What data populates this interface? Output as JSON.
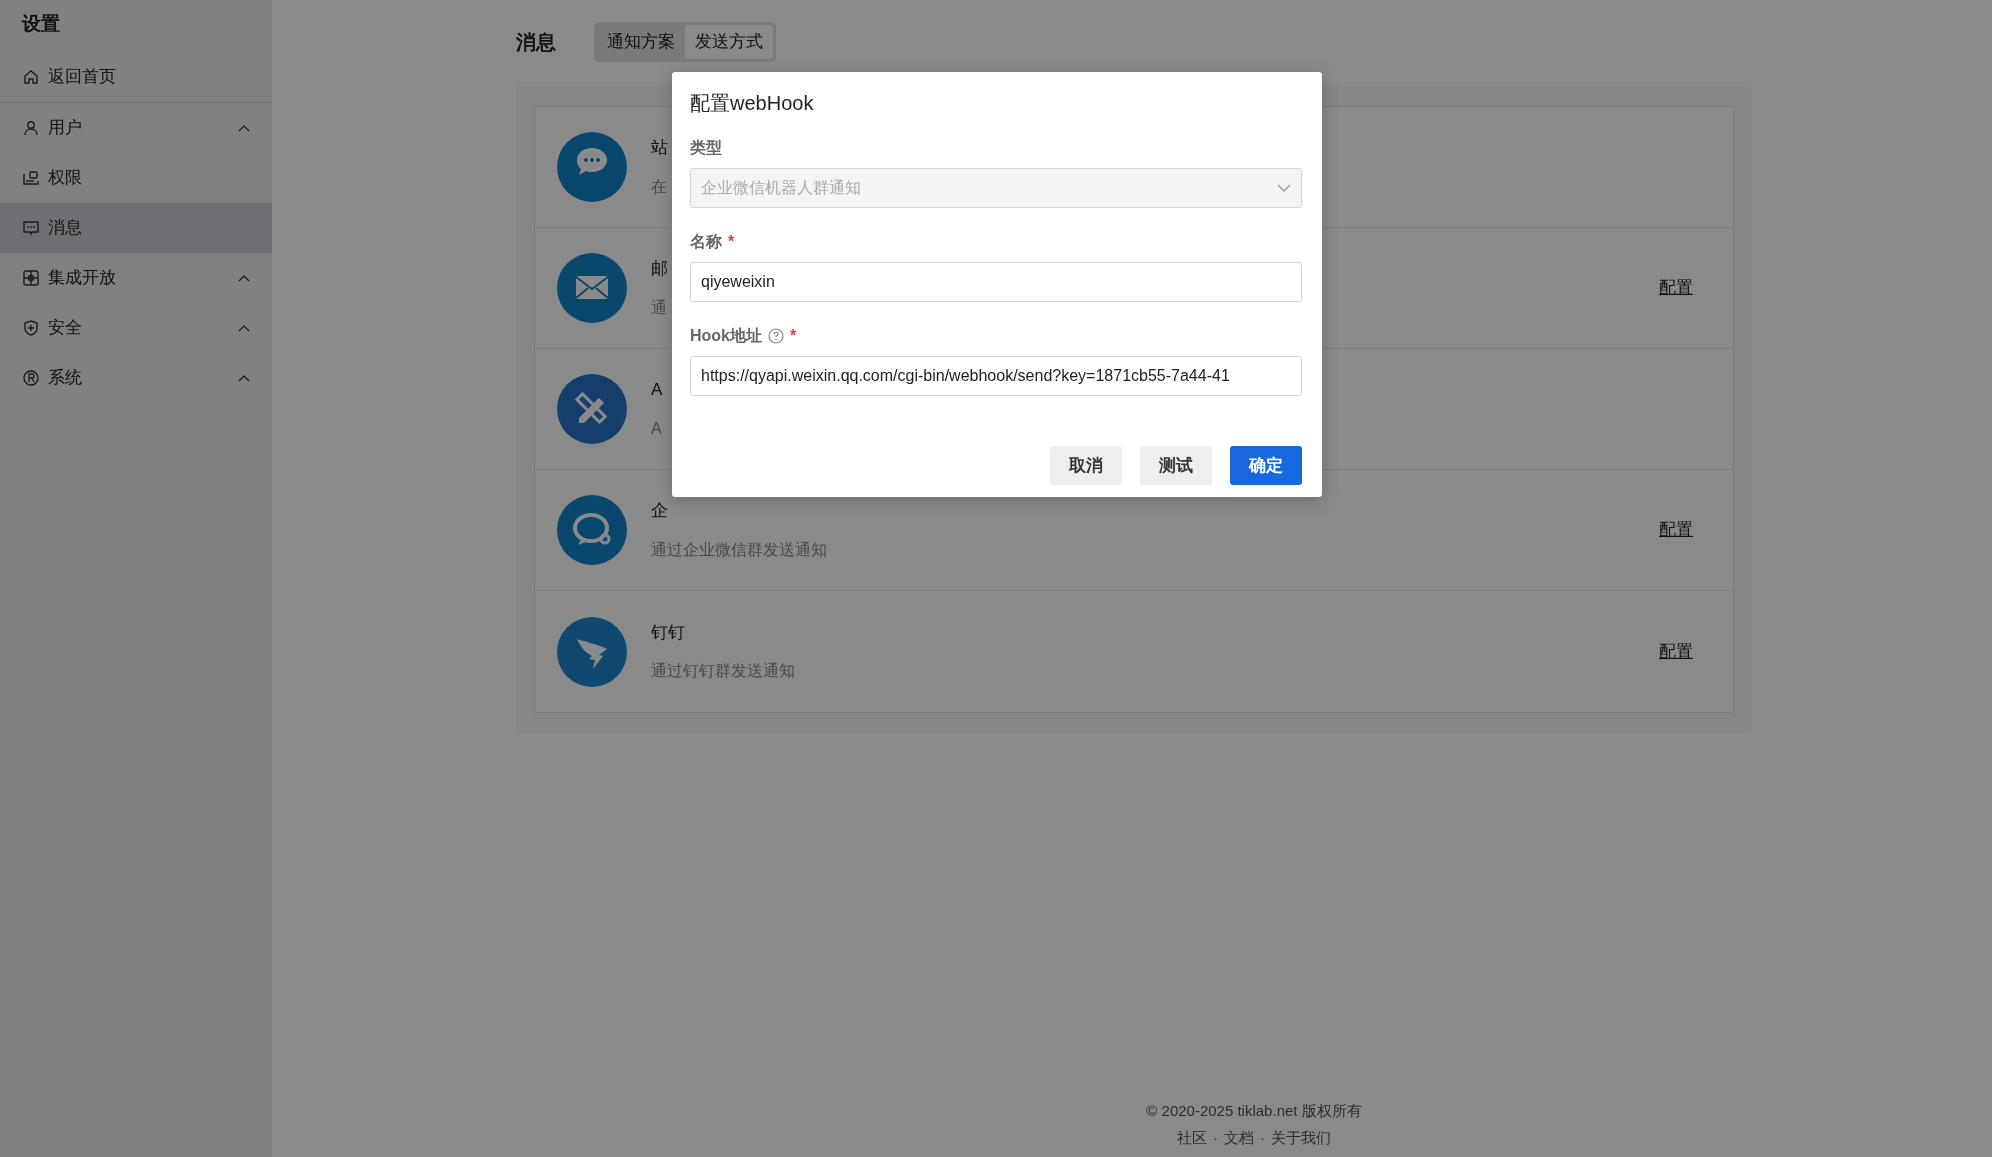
{
  "sidebar": {
    "title": "设置",
    "items": [
      {
        "label": "返回首页",
        "kind": "link",
        "selected": false
      },
      {
        "label": "用户",
        "kind": "group",
        "selected": false
      },
      {
        "label": "权限",
        "kind": "link",
        "selected": false
      },
      {
        "label": "消息",
        "kind": "link",
        "selected": true
      },
      {
        "label": "集成开放",
        "kind": "group",
        "selected": false
      },
      {
        "label": "安全",
        "kind": "group",
        "selected": false
      },
      {
        "label": "系统",
        "kind": "group",
        "selected": false
      }
    ]
  },
  "header": {
    "title": "消息",
    "tabs": [
      {
        "label": "通知方案",
        "selected": false
      },
      {
        "label": "发送方式",
        "selected": true
      }
    ]
  },
  "channels": [
    {
      "name": "站",
      "description": "在"
    },
    {
      "name": "邮",
      "description": "通",
      "action": "配置"
    },
    {
      "name": "A",
      "description": "A"
    },
    {
      "name": "企",
      "description": "通过企业微信群发送通知",
      "action": "配置"
    },
    {
      "name": "钉钉",
      "description": "通过钉钉群发送通知",
      "action": "配置"
    }
  ],
  "dialog": {
    "title": "配置webHook",
    "fields": [
      {
        "label": "类型",
        "value": "企业微信机器人群通知",
        "kind": "select",
        "disabled": true,
        "required": false,
        "help": false
      },
      {
        "label": "名称",
        "value": "qiyeweixin",
        "kind": "text",
        "disabled": false,
        "required": true,
        "help": false
      },
      {
        "label": "Hook地址",
        "value": "https://qyapi.weixin.qq.com/cgi-bin/webhook/send?key=1871cb55-7a44-41",
        "kind": "text",
        "disabled": false,
        "required": true,
        "help": true
      }
    ],
    "required_mark": "*",
    "buttons": [
      {
        "label": "取消",
        "kind": "secondary"
      },
      {
        "label": "测试",
        "kind": "secondary"
      },
      {
        "label": "确定",
        "kind": "primary"
      }
    ]
  },
  "footer": {
    "copyright": "© 2020-2025 tiklab.net 版权所有",
    "separator": "·",
    "links": [
      "社区",
      "文档",
      "关于我们"
    ]
  }
}
